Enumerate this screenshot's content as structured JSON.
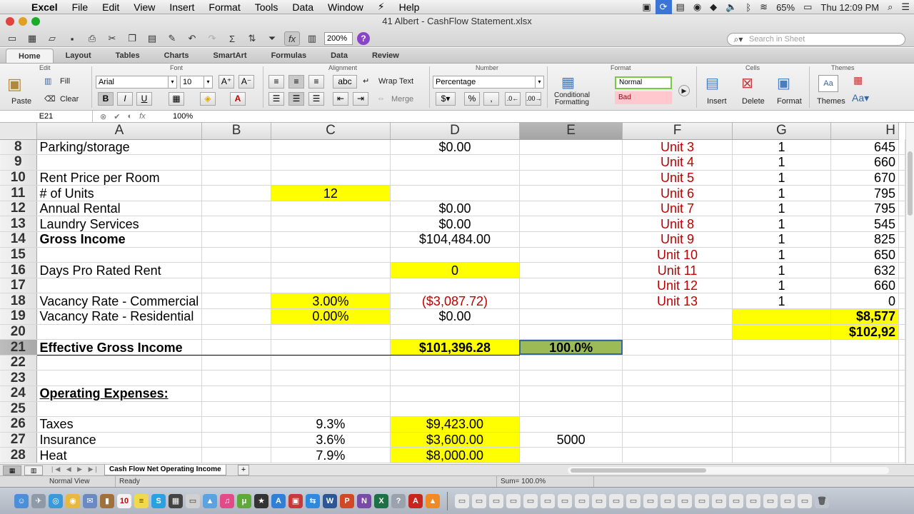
{
  "menubar": {
    "app": "Excel",
    "items": [
      "File",
      "Edit",
      "View",
      "Insert",
      "Format",
      "Tools",
      "Data",
      "Window",
      "Help"
    ],
    "battery": "65%",
    "clock": "Thu 12:09 PM"
  },
  "window": {
    "title": "41 Albert - CashFlow Statement.xlsx",
    "zoom": "200%",
    "search_placeholder": "Search in Sheet"
  },
  "ribbon_tabs": [
    "Home",
    "Layout",
    "Tables",
    "Charts",
    "SmartArt",
    "Formulas",
    "Data",
    "Review"
  ],
  "ribbon": {
    "groups": {
      "edit": "Edit",
      "font": "Font",
      "alignment": "Alignment",
      "number": "Number",
      "format": "Format",
      "cells": "Cells",
      "themes": "Themes"
    },
    "paste": "Paste",
    "fill": "Fill",
    "clear": "Clear",
    "font_name": "Arial",
    "font_size": "10",
    "wrap_text": "Wrap Text",
    "merge": "Merge",
    "number_format": "Percentage",
    "conditional_formatting": "Conditional Formatting",
    "style_normal": "Normal",
    "style_bad": "Bad",
    "insert": "Insert",
    "delete": "Delete",
    "format_btn": "Format",
    "themes_btn": "Themes"
  },
  "formula_bar": {
    "cell_ref": "E21",
    "value": "100%"
  },
  "columns": [
    "A",
    "B",
    "C",
    "D",
    "E",
    "F",
    "G",
    "H"
  ],
  "rows": [
    {
      "n": "8",
      "A": "Parking/storage",
      "C": "",
      "D": "$0.00",
      "E": "",
      "F": "Unit 3",
      "G": "1",
      "H": "645"
    },
    {
      "n": "9",
      "A": "",
      "C": "",
      "D": "",
      "E": "",
      "F": "Unit 4",
      "G": "1",
      "H": "660"
    },
    {
      "n": "10",
      "A": "Rent Price per Room",
      "C": "",
      "D": "",
      "E": "",
      "F": "Unit 5",
      "G": "1",
      "H": "670"
    },
    {
      "n": "11",
      "A": "# of Units",
      "C": "12",
      "D": "",
      "E": "",
      "F": "Unit 6",
      "G": "1",
      "H": "795"
    },
    {
      "n": "12",
      "A": "Annual Rental",
      "C": "",
      "D": "$0.00",
      "E": "",
      "F": "Unit 7",
      "G": "1",
      "H": "795"
    },
    {
      "n": "13",
      "A": "Laundry Services",
      "C": "",
      "D": "$0.00",
      "E": "",
      "F": "Unit 8",
      "G": "1",
      "H": "545"
    },
    {
      "n": "14",
      "A": "Gross Income",
      "C": "",
      "D": "$104,484.00",
      "E": "",
      "F": "Unit 9",
      "G": "1",
      "H": "825"
    },
    {
      "n": "15",
      "A": "",
      "C": "",
      "D": "",
      "E": "",
      "F": "Unit 10",
      "G": "1",
      "H": "650"
    },
    {
      "n": "16",
      "A": "Days Pro Rated Rent",
      "C": "",
      "D": "0",
      "E": "",
      "F": "Unit 11",
      "G": "1",
      "H": "632"
    },
    {
      "n": "17",
      "A": "",
      "C": "",
      "D": "",
      "E": "",
      "F": "Unit 12",
      "G": "1",
      "H": "660"
    },
    {
      "n": "18",
      "A": "Vacancy Rate - Commercial",
      "C": "3.00%",
      "D": "($3,087.72)",
      "E": "",
      "F": "Unit 13",
      "G": "1",
      "H": "0"
    },
    {
      "n": "19",
      "A": "Vacancy Rate - Residential",
      "C": "0.00%",
      "D": "$0.00",
      "E": "",
      "F": "",
      "G": "",
      "H": "$8,577"
    },
    {
      "n": "20",
      "A": "",
      "C": "",
      "D": "",
      "E": "",
      "F": "",
      "G": "",
      "H": "$102,92"
    },
    {
      "n": "21",
      "A": "Effective Gross Income",
      "C": "",
      "D": "$101,396.28",
      "E": "100.0%",
      "F": "",
      "G": "",
      "H": ""
    },
    {
      "n": "22",
      "A": "",
      "C": "",
      "D": "",
      "E": "",
      "F": "",
      "G": "",
      "H": ""
    },
    {
      "n": "23",
      "A": "",
      "C": "",
      "D": "",
      "E": "",
      "F": "",
      "G": "",
      "H": ""
    },
    {
      "n": "24",
      "A": "Operating Expenses:",
      "C": "",
      "D": "",
      "E": "",
      "F": "",
      "G": "",
      "H": ""
    },
    {
      "n": "25",
      "A": "",
      "C": "",
      "D": "",
      "E": "",
      "F": "",
      "G": "",
      "H": ""
    },
    {
      "n": "26",
      "A": "Taxes",
      "C": "9.3%",
      "D": "$9,423.00",
      "E": "",
      "F": "",
      "G": "",
      "H": ""
    },
    {
      "n": "27",
      "A": "Insurance",
      "C": "3.6%",
      "D": "$3,600.00",
      "E": "5000",
      "F": "",
      "G": "",
      "H": ""
    },
    {
      "n": "28",
      "A": "Heat",
      "C": "7.9%",
      "D": "$8,000.00",
      "E": "",
      "F": "",
      "G": "",
      "H": ""
    }
  ],
  "sheet": {
    "tab": "Cash Flow Net Operating Income",
    "add": "+"
  },
  "status": {
    "view": "Normal View",
    "state": "Ready",
    "sum": "Sum= 100.0%"
  },
  "colors": {
    "highlight": "#ffff00",
    "selected_cell": "#9bbb59",
    "unit_text": "#c00000"
  }
}
